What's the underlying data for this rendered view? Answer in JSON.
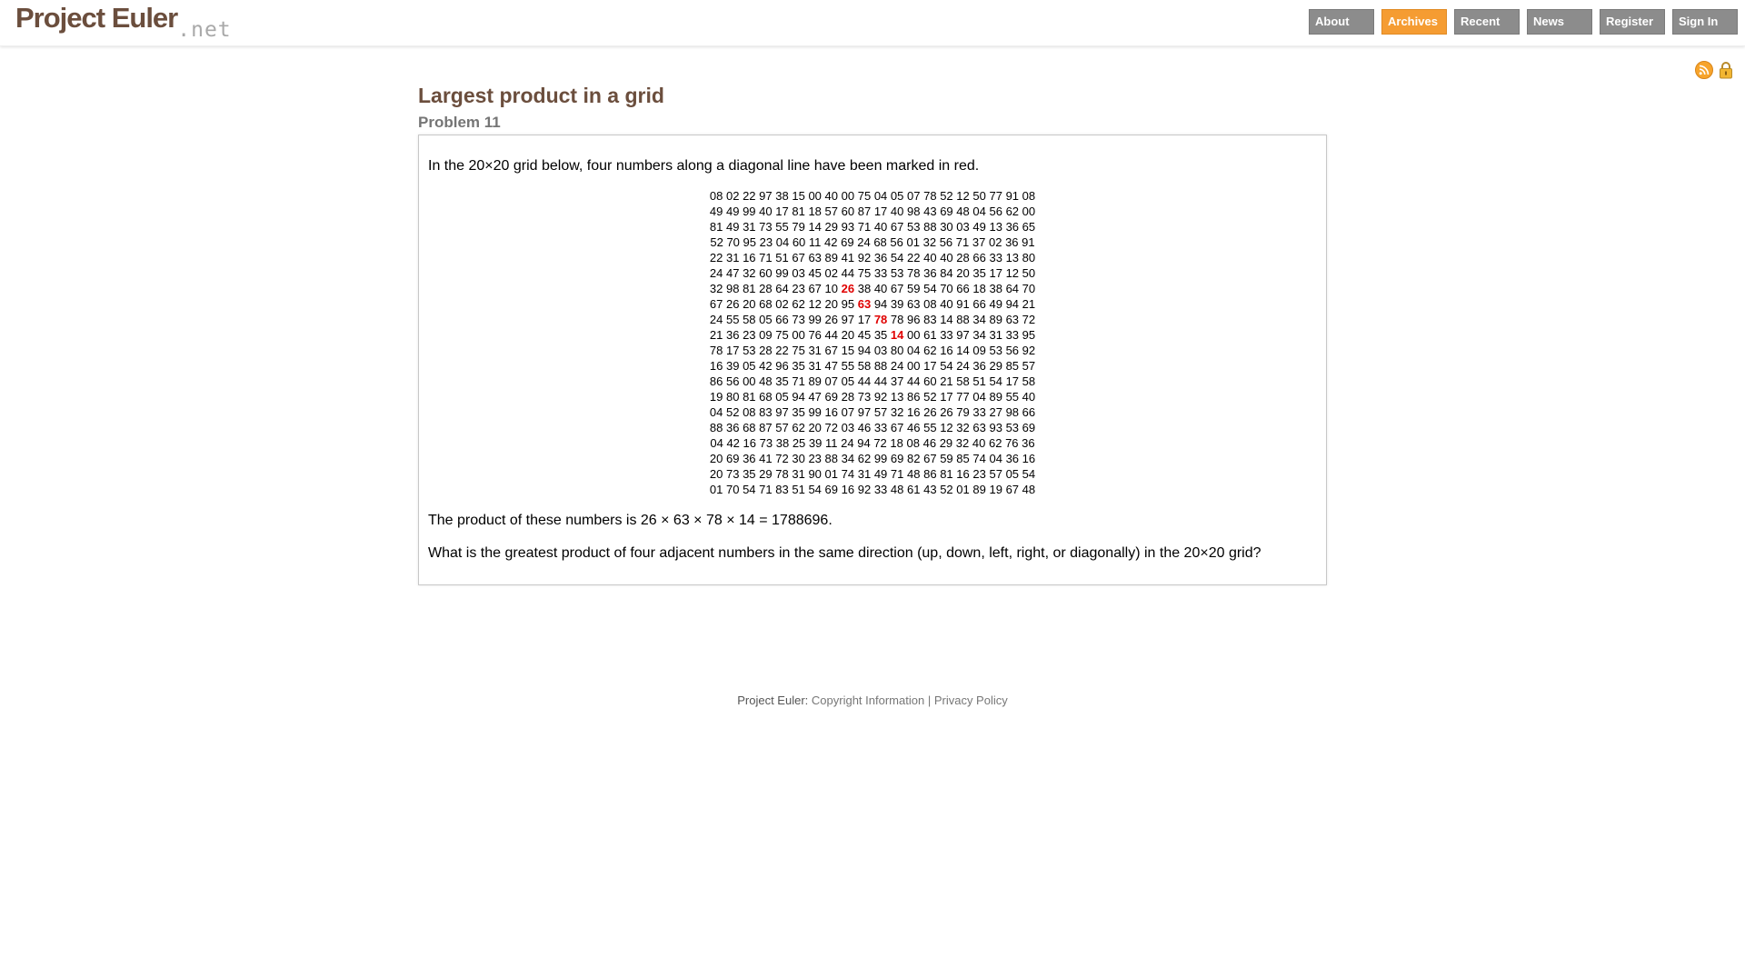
{
  "header": {
    "logo_main": "Project Euler",
    "logo_suffix": ".net",
    "nav": [
      {
        "label": "About",
        "active": false
      },
      {
        "label": "Archives",
        "active": true
      },
      {
        "label": "Recent",
        "active": false
      },
      {
        "label": "News",
        "active": false
      },
      {
        "label": "Register",
        "active": false
      },
      {
        "label": "Sign In",
        "active": false
      }
    ],
    "icons": [
      "rss-icon",
      "lock-icon"
    ],
    "accent_color": "#f59c32",
    "brand_color": "#6b4e3d"
  },
  "problem": {
    "title": "Largest product in a grid",
    "number_label": "Problem 11",
    "intro": "In the 20×20 grid below, four numbers along a diagonal line have been marked in red.",
    "grid": [
      "08 02 22 97 38 15 00 40 00 75 04 05 07 78 52 12 50 77 91 08",
      "49 49 99 40 17 81 18 57 60 87 17 40 98 43 69 48 04 56 62 00",
      "81 49 31 73 55 79 14 29 93 71 40 67 53 88 30 03 49 13 36 65",
      "52 70 95 23 04 60 11 42 69 24 68 56 01 32 56 71 37 02 36 91",
      "22 31 16 71 51 67 63 89 41 92 36 54 22 40 40 28 66 33 13 80",
      "24 47 32 60 99 03 45 02 44 75 33 53 78 36 84 20 35 17 12 50",
      "32 98 81 28 64 23 67 10 26 38 40 67 59 54 70 66 18 38 64 70",
      "67 26 20 68 02 62 12 20 95 63 94 39 63 08 40 91 66 49 94 21",
      "24 55 58 05 66 73 99 26 97 17 78 78 96 83 14 88 34 89 63 72",
      "21 36 23 09 75 00 76 44 20 45 35 14 00 61 33 97 34 31 33 95",
      "78 17 53 28 22 75 31 67 15 94 03 80 04 62 16 14 09 53 56 92",
      "16 39 05 42 96 35 31 47 55 58 88 24 00 17 54 24 36 29 85 57",
      "86 56 00 48 35 71 89 07 05 44 44 37 44 60 21 58 51 54 17 58",
      "19 80 81 68 05 94 47 69 28 73 92 13 86 52 17 77 04 89 55 40",
      "04 52 08 83 97 35 99 16 07 97 57 32 16 26 26 79 33 27 98 66",
      "88 36 68 87 57 62 20 72 03 46 33 67 46 55 12 32 63 93 53 69",
      "04 42 16 73 38 25 39 11 24 94 72 18 08 46 29 32 40 62 76 36",
      "20 69 36 41 72 30 23 88 34 62 99 69 82 67 59 85 74 04 36 16",
      "20 73 35 29 78 31 90 01 74 31 49 71 48 86 81 16 23 57 05 54",
      "01 70 54 71 83 51 54 69 16 92 33 48 61 43 52 01 89 19 67 48"
    ],
    "highlighted_cells": [
      {
        "row": 6,
        "col": 8
      },
      {
        "row": 7,
        "col": 9
      },
      {
        "row": 8,
        "col": 10
      },
      {
        "row": 9,
        "col": 11
      }
    ],
    "highlight_color": "#e00000",
    "product_text": "The product of these numbers is 26 × 63 × 78 × 14 = 1788696.",
    "question": "What is the greatest product of four adjacent numbers in the same direction (up, down, left, right, or diagonally) in the 20×20 grid?"
  },
  "footer": {
    "prefix": "Project Euler:",
    "copyright_link": "Copyright Information",
    "separator": "|",
    "privacy_link": "Privacy Policy"
  }
}
